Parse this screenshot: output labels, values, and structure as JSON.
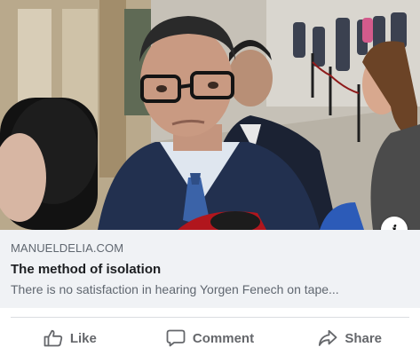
{
  "link": {
    "domain": "MANUELDELIA.COM",
    "title": "The method of isolation",
    "description": "There is no satisfaction in hearing Yorgen Fenech on tape..."
  },
  "info_button": {
    "label": "i",
    "icon": "info-icon"
  },
  "actions": {
    "like": {
      "label": "Like",
      "icon": "thumbs-up-icon"
    },
    "comment": {
      "label": "Comment",
      "icon": "comment-icon"
    },
    "share": {
      "label": "Share",
      "icon": "share-icon"
    }
  },
  "colors": {
    "card_background": "#f0f2f5",
    "secondary_text": "#606770",
    "action_text": "#65676b"
  }
}
